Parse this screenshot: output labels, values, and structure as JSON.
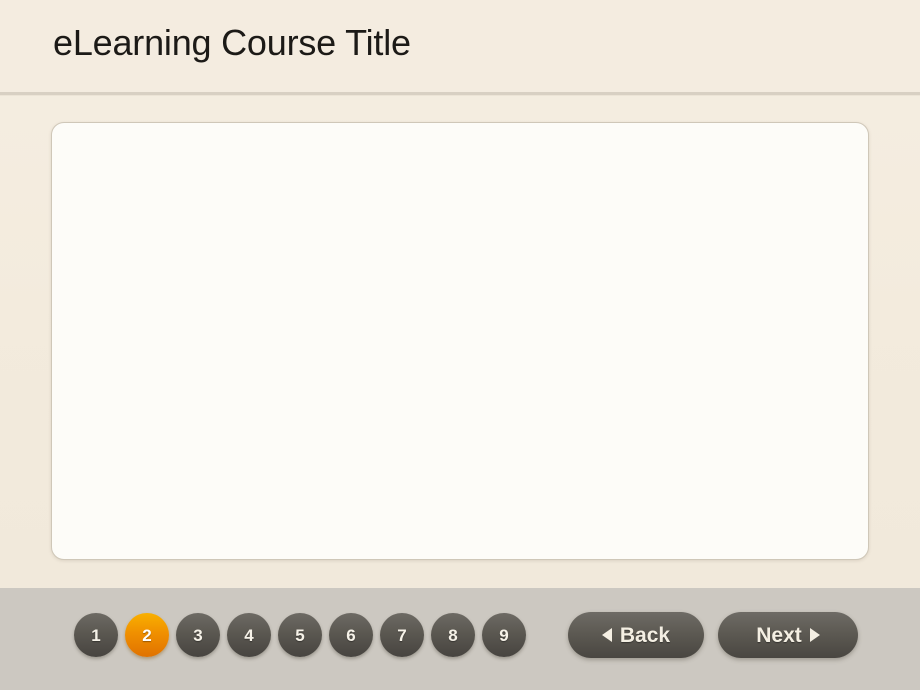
{
  "header": {
    "title": "eLearning Course Title"
  },
  "stage": {
    "content": ""
  },
  "footer": {
    "pages": [
      {
        "label": "1",
        "active": false
      },
      {
        "label": "2",
        "active": true
      },
      {
        "label": "3",
        "active": false
      },
      {
        "label": "4",
        "active": false
      },
      {
        "label": "5",
        "active": false
      },
      {
        "label": "6",
        "active": false
      },
      {
        "label": "7",
        "active": false
      },
      {
        "label": "8",
        "active": false
      },
      {
        "label": "9",
        "active": false
      }
    ],
    "current_page": "2",
    "total_pages": "9",
    "back_label": "Back",
    "next_label": "Next",
    "back_icon": "triangle-left-icon",
    "next_icon": "triangle-right-icon"
  },
  "colors": {
    "header_bg": "#f4ece0",
    "body_bg": "#f3ebdd",
    "footer_bg": "#ccc8c1",
    "stage_bg": "#fdfcf8",
    "stage_border": "#cfc7b8",
    "divider": "#d8d0c3",
    "dot_inactive": "#5c5952",
    "dot_active": "#f09000",
    "button_bg": "#5d5a53",
    "button_text": "#f4efe3",
    "title_text": "#1c1a17"
  }
}
